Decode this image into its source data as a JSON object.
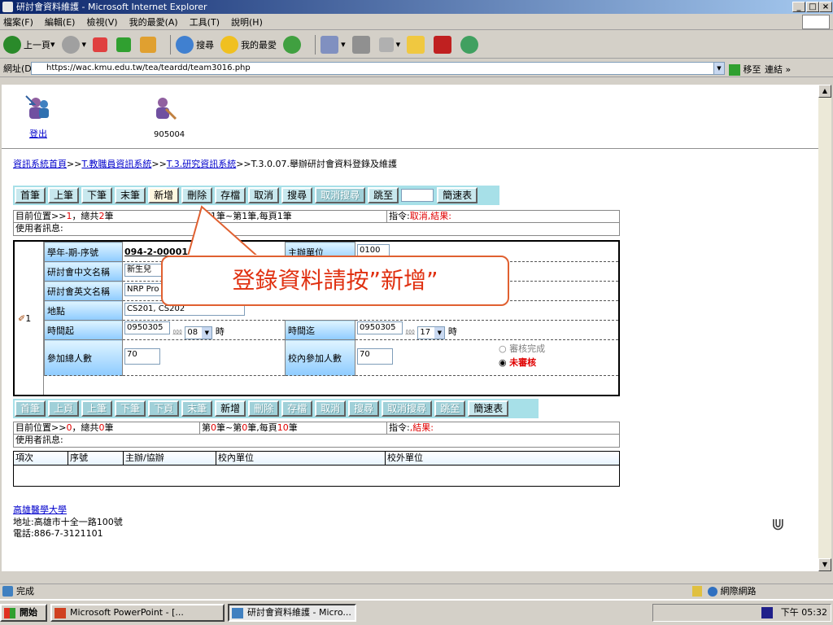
{
  "window": {
    "title": "研討會資料維護 - Microsoft Internet Explorer"
  },
  "menu": [
    "檔案(F)",
    "編輯(E)",
    "檢視(V)",
    "我的最愛(A)",
    "工具(T)",
    "說明(H)"
  ],
  "toolbar": {
    "back": "上一頁",
    "search": "搜尋",
    "favorites": "我的最愛"
  },
  "address": {
    "label": "網址(D)",
    "url": "https://wac.kmu.edu.tw/tea/teardd/team3016.php",
    "go": "移至",
    "links": "連結"
  },
  "header": {
    "logout": "登出",
    "user_id": "905004"
  },
  "breadcrumb": {
    "home": "資訊系統首頁",
    "sep": ">>",
    "l1": "T.教職員資訊系統",
    "l2": "T.3.研究資訊系統",
    "current": ">>T.3.0.07.舉辦研討會資料登錄及維護"
  },
  "buttons1": [
    "首筆",
    "上筆",
    "下筆",
    "末筆",
    "新增",
    "刪除",
    "存檔",
    "取消",
    "搜尋",
    "取消搜尋",
    "跳至",
    "簡速表"
  ],
  "status1": {
    "pos": "目前位置>>",
    "pos_val": "1",
    "total": "，總共",
    "total_val": "2",
    "unit": "筆",
    "page": "第1筆~第1筆,每頁1筆",
    "cmd": "指令:",
    "cmd_val": "取消,結果:",
    "user_msg": "使用者訊息:"
  },
  "record": {
    "index": "1",
    "year_label": "學年-期-序號",
    "year_value": "094-2-00001",
    "dept_label": "主辦單位",
    "dept_value": "0100",
    "cn_label": "研討會中文名稱",
    "cn_value": "新生兒",
    "en_label": "研討會英文名稱",
    "en_value": "NRP Pro",
    "place_label": "地點",
    "place_value": "CS201, CS202",
    "start_label": "時間起",
    "start_date": "0950305",
    "start_hour": "08",
    "hour_unit": "時",
    "end_label": "時間迄",
    "end_date": "0950305",
    "end_hour": "17",
    "total_label": "參加總人數",
    "total_value": "70",
    "inner_label": "校內參加人數",
    "inner_value": "70",
    "radio1": "審核完成",
    "radio2": "未審核"
  },
  "callout": "登錄資料請按”新增”",
  "buttons2": [
    "首筆",
    "上頁",
    "上筆",
    "下筆",
    "下頁",
    "末筆",
    "新增",
    "刪除",
    "存檔",
    "取消",
    "搜尋",
    "取消搜尋",
    "跳至",
    "簡速表"
  ],
  "status2": {
    "pos": "目前位置>>",
    "pos_val": "0",
    "total": "，總共",
    "total_val": "0",
    "unit": "筆",
    "page_a": "第",
    "page_b": "0",
    "page_c": "筆~第",
    "page_d": "0",
    "page_e": "筆,每頁",
    "page_f": "10",
    "page_g": "筆",
    "cmd": "指令:",
    "cmd_val": ",結果:",
    "user_msg": "使用者訊息:"
  },
  "subtable": {
    "headers": [
      "項次",
      "序號",
      "主辦/協辦",
      "校內單位",
      "校外單位"
    ]
  },
  "footer": {
    "org": "高雄醫學大學",
    "addr": "地址:高雄市十全一路100號",
    "tel": "電話:886-7-3121101"
  },
  "statusbar": {
    "done": "完成",
    "zone": "網際網路"
  },
  "taskbar": {
    "start": "開始",
    "task1": "Microsoft PowerPoint - [...",
    "task2": "研討會資料維護 - Micro...",
    "clock": "下午 05:32"
  },
  "colors": {
    "accent": "#e03010",
    "link": "#0000cc",
    "button_bar": "#a7e0e8"
  }
}
